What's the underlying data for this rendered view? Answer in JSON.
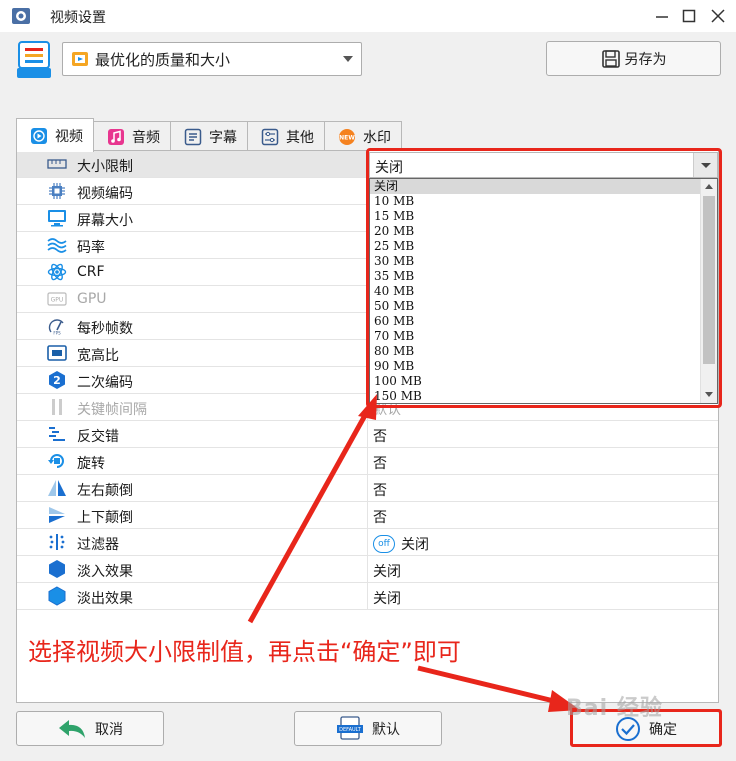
{
  "window": {
    "title": "视频设置",
    "controls": [
      "minimize-icon",
      "maximize-icon",
      "close-icon"
    ]
  },
  "toolbar": {
    "preset_value": "最优化的质量和大小",
    "save_as_label": "另存为"
  },
  "tabs": [
    {
      "label": "视频",
      "icon": "video-play-icon",
      "active": true
    },
    {
      "label": "音频",
      "icon": "music-note-icon",
      "active": false
    },
    {
      "label": "字幕",
      "icon": "subtitle-icon",
      "active": false
    },
    {
      "label": "其他",
      "icon": "sliders-icon",
      "active": false
    },
    {
      "label": "水印",
      "icon": "new-badge-icon",
      "active": false
    }
  ],
  "settings": [
    {
      "name": "大小限制",
      "value": "关闭",
      "icon": "ruler-icon",
      "disabled": false
    },
    {
      "name": "视频编码",
      "value": "",
      "icon": "chip-icon",
      "disabled": false
    },
    {
      "name": "屏幕大小",
      "value": "",
      "icon": "monitor-icon",
      "disabled": false
    },
    {
      "name": "码率",
      "value": "",
      "icon": "wave-icon",
      "disabled": false
    },
    {
      "name": "CRF",
      "value": "",
      "icon": "atom-icon",
      "disabled": false
    },
    {
      "name": "GPU",
      "value": "",
      "icon": "gpu-icon",
      "disabled": true
    },
    {
      "name": "每秒帧数",
      "value": "",
      "icon": "fps-gauge-icon",
      "disabled": false
    },
    {
      "name": "宽高比",
      "value": "",
      "icon": "aspect-ratio-icon",
      "disabled": false
    },
    {
      "name": "二次编码",
      "value": "",
      "icon": "two-pass-icon",
      "disabled": false
    },
    {
      "name": "关键帧间隔",
      "value": "默认",
      "icon": "keyframe-icon",
      "disabled": true
    },
    {
      "name": "反交错",
      "value": "否",
      "icon": "deinterlace-icon",
      "disabled": false
    },
    {
      "name": "旋转",
      "value": "否",
      "icon": "rotate-icon",
      "disabled": false
    },
    {
      "name": "左右颠倒",
      "value": "否",
      "icon": "flip-horizontal-icon",
      "disabled": false
    },
    {
      "name": "上下颠倒",
      "value": "否",
      "icon": "flip-vertical-icon",
      "disabled": false
    },
    {
      "name": "过滤器",
      "value": "关闭",
      "icon": "filter-icon",
      "disabled": false,
      "badge": "off"
    },
    {
      "name": "淡入效果",
      "value": "关闭",
      "icon": "fade-in-hexagon-icon",
      "disabled": false
    },
    {
      "name": "淡出效果",
      "value": "关闭",
      "icon": "fade-out-hexagon-icon",
      "disabled": false
    }
  ],
  "size_limit_dropdown": {
    "selected": "关闭",
    "options": [
      "关闭",
      "10 MB",
      "15 MB",
      "20 MB",
      "25 MB",
      "30 MB",
      "35 MB",
      "40 MB",
      "50 MB",
      "60 MB",
      "70 MB",
      "80 MB",
      "90 MB",
      "100 MB",
      "150 MB"
    ]
  },
  "annotation": "选择视频大小限制值，再点击“确定”即可",
  "buttons": {
    "cancel": "取消",
    "default": "默认",
    "ok": "确定"
  },
  "watermark_text": "Bai 经验",
  "colors": {
    "annotation_red": "#e8261b",
    "accent_blue": "#1a8fe6",
    "window_bg": "#f0f0f0"
  }
}
